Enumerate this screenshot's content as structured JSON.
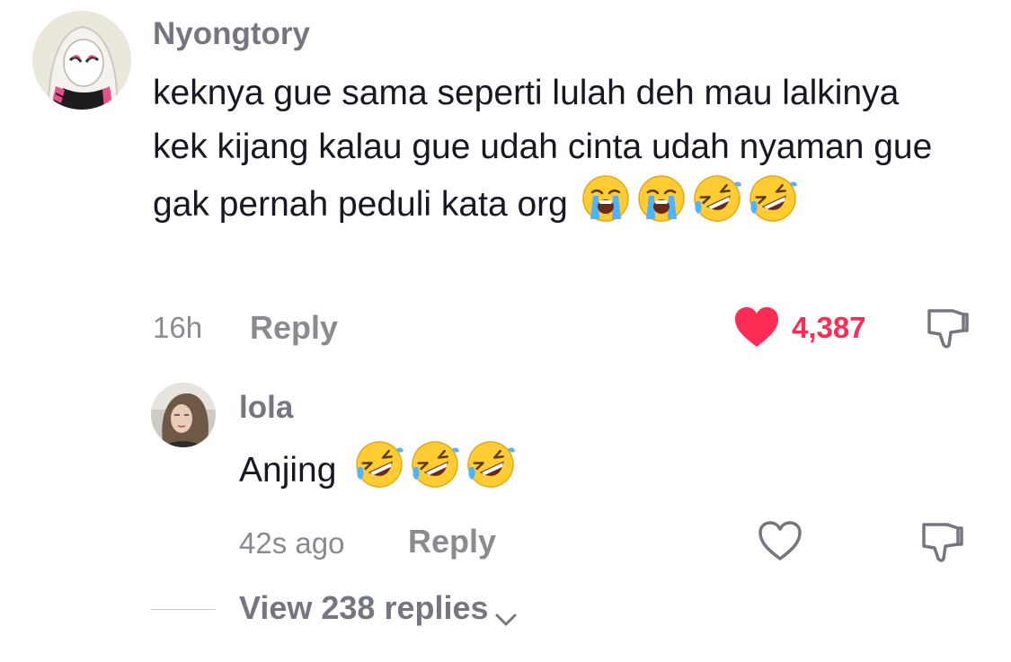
{
  "comment": {
    "username": "Nyongtory",
    "text": "keknya gue sama seperti lulah deh mau lalkinya kek kijang kalau gue udah cinta udah nyaman gue gak pernah peduli kata org",
    "emojis": [
      "loudly-crying-face",
      "loudly-crying-face",
      "rolling-on-floor-laughing",
      "rolling-on-floor-laughing"
    ],
    "time": "16h",
    "reply_label": "Reply",
    "like_count": "4,387",
    "liked": true,
    "like_color": "#fe2c55"
  },
  "reply": {
    "username": "lola",
    "text": "Anjing",
    "emojis": [
      "rolling-on-floor-laughing",
      "rolling-on-floor-laughing",
      "rolling-on-floor-laughing"
    ],
    "time": "42s ago",
    "reply_label": "Reply",
    "liked": false
  },
  "view_replies": {
    "label": "View 238 replies",
    "icon": "chevron-down-icon"
  },
  "colors": {
    "text": "#161823",
    "muted": "#8a8b91",
    "username": "#757780",
    "accent": "#fe2c55"
  }
}
